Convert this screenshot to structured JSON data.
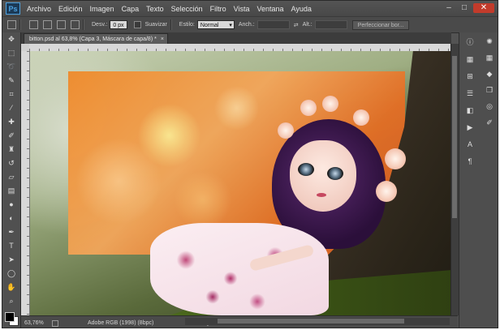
{
  "app": {
    "logo": "Ps"
  },
  "menu": [
    "Archivo",
    "Edición",
    "Imagen",
    "Capa",
    "Texto",
    "Selección",
    "Filtro",
    "Vista",
    "Ventana",
    "Ayuda"
  ],
  "window_controls": {
    "minimize": "–",
    "maximize": "□",
    "close": "✕"
  },
  "options": {
    "feather_label": "Desv.:",
    "feather_value": "0 px",
    "antialias_label": "Suavizar",
    "style_label": "Estilo:",
    "style_value": "Normal",
    "width_label": "Anch.:",
    "height_label": "Alt.:",
    "refine_button": "Perfeccionar bor..."
  },
  "document": {
    "tab_title": "bitton.psd al 63,8% (Capa 3, Máscara de capa/8) *",
    "close": "×"
  },
  "status": {
    "zoom": "63,76%",
    "doc_info": "Adobe RGB (1998) (8bpc)",
    "arrow": "▶"
  },
  "tools": [
    "marquee-move",
    "marquee-rect",
    "lasso",
    "quick-select",
    "crop",
    "eyedropper",
    "spot-heal",
    "brush",
    "clone-stamp",
    "history-brush",
    "eraser",
    "gradient",
    "blur",
    "dodge",
    "pen",
    "type",
    "path-select",
    "shape",
    "hand",
    "zoom"
  ],
  "colors": {
    "chrome": "#535353",
    "menubar": "#4a4a4a",
    "accent": "#4ea2e0"
  }
}
